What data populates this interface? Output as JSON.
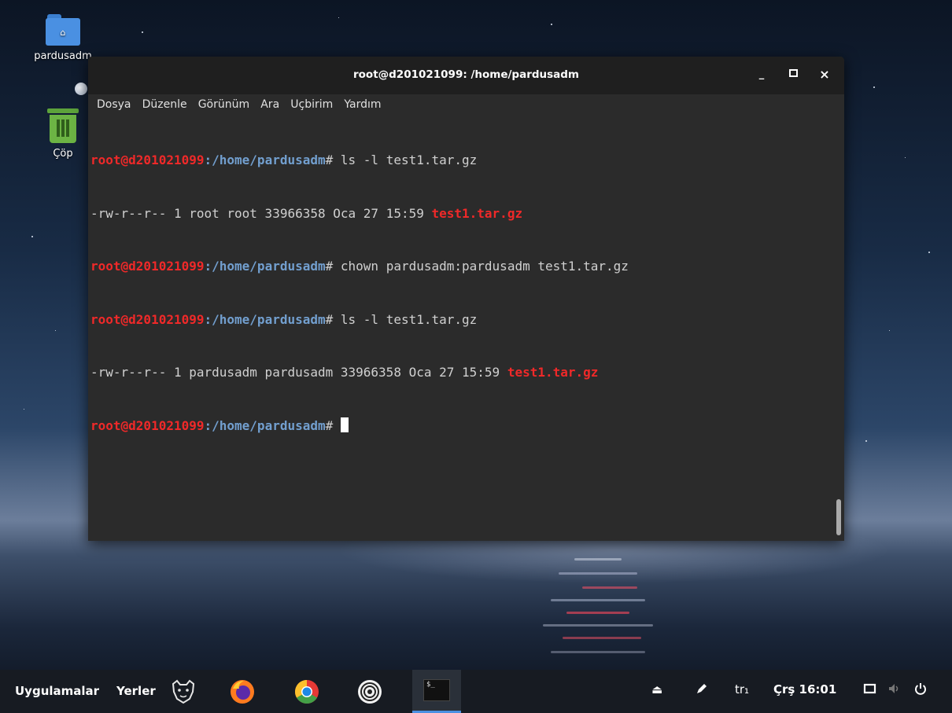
{
  "desktop": {
    "icons": [
      {
        "label": "pardusadm",
        "icon": "home-folder-icon"
      },
      {
        "label": "Çöp",
        "icon": "trash-icon"
      }
    ]
  },
  "window": {
    "title": "root@d201021099: /home/pardusadm",
    "controls": {
      "minimize": "_",
      "maximize": "□",
      "close": "×"
    }
  },
  "menu": [
    "Dosya",
    "Düzenle",
    "Görünüm",
    "Ara",
    "Uçbirim",
    "Yardım"
  ],
  "terminal": {
    "prompt_user": "root@d201021099",
    "prompt_path": ":/home/pardusadm",
    "prompt_symbol": "# ",
    "lines": [
      {
        "type": "prompt",
        "cmd": "ls -l test1.tar.gz"
      },
      {
        "type": "output",
        "text": "-rw-r--r-- 1 root root 33966358 Oca 27 15:59 ",
        "file": "test1.tar.gz"
      },
      {
        "type": "prompt",
        "cmd": "chown pardusadm:pardusadm test1.tar.gz"
      },
      {
        "type": "prompt",
        "cmd": "ls -l test1.tar.gz"
      },
      {
        "type": "output",
        "text": "-rw-r--r-- 1 pardusadm pardusadm 33966358 Oca 27 15:59 ",
        "file": "test1.tar.gz"
      },
      {
        "type": "prompt",
        "cmd": ""
      }
    ],
    "colors": {
      "user": "#ef2929",
      "path": "#729fcf",
      "file": "#ef2929",
      "background": "#2b2b2b"
    }
  },
  "taskbar": {
    "apps_label": "Uygulamalar",
    "places_label": "Yerler",
    "launchers": [
      "pardus-leopard-icon",
      "firefox-icon",
      "chrome-icon",
      "pardus-spiral-icon"
    ],
    "active_task": "terminal-icon",
    "tray": {
      "eject": "⏏",
      "pen": "pen-icon",
      "keyboard": "tr₁",
      "clock": "Çrş 16:01",
      "screen": "screen-icon",
      "volume": "volume-icon",
      "power": "power-icon"
    }
  }
}
